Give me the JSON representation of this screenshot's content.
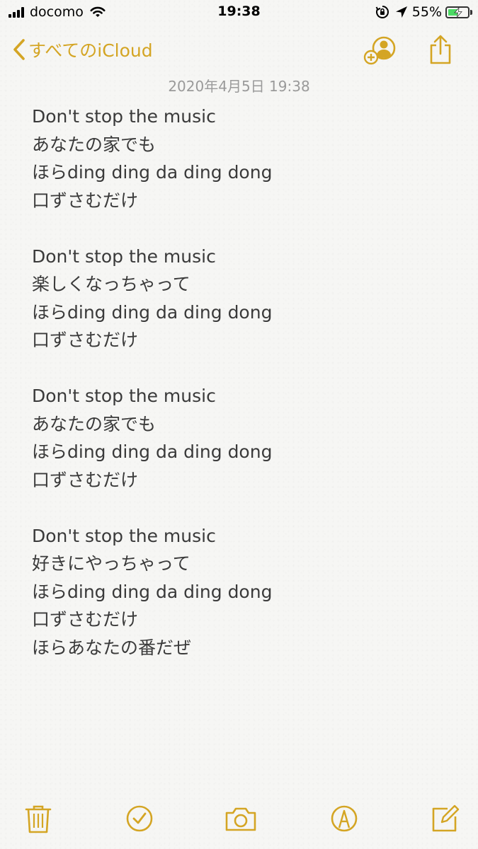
{
  "status_bar": {
    "carrier": "docomo",
    "time": "19:38",
    "battery_percent": "55%",
    "battery_level": 0.55,
    "icons": [
      "signal-icon",
      "wifi-icon",
      "rotation-lock-icon",
      "location-icon",
      "battery-icon"
    ]
  },
  "nav": {
    "back_label": "すべてのiCloud",
    "icons": [
      "chevron-left-icon",
      "add-person-icon",
      "share-icon"
    ]
  },
  "note": {
    "date": "2020年4月5日 19:38",
    "lines": [
      "Don't stop the music",
      "あなたの家でも",
      "ほらding ding da ding dong",
      "口ずさむだけ",
      "",
      "Don't stop the music",
      "楽しくなっちゃって",
      "ほらding ding da ding dong",
      "口ずさむだけ",
      "",
      "Don't stop the music",
      "あなたの家でも",
      "ほらding ding da ding dong",
      "口ずさむだけ",
      "",
      "Don't stop the music",
      "好きにやっちゃって",
      "ほらding ding da ding dong",
      "口ずさむだけ",
      "ほらあなたの番だぜ"
    ]
  },
  "toolbar": {
    "icons": [
      "trash-icon",
      "checklist-icon",
      "camera-icon",
      "markup-icon",
      "compose-icon"
    ]
  },
  "colors": {
    "accent": "#d4a524",
    "text": "#3a3a3a",
    "date": "#9a9a9a",
    "battery": "#4cd964"
  }
}
